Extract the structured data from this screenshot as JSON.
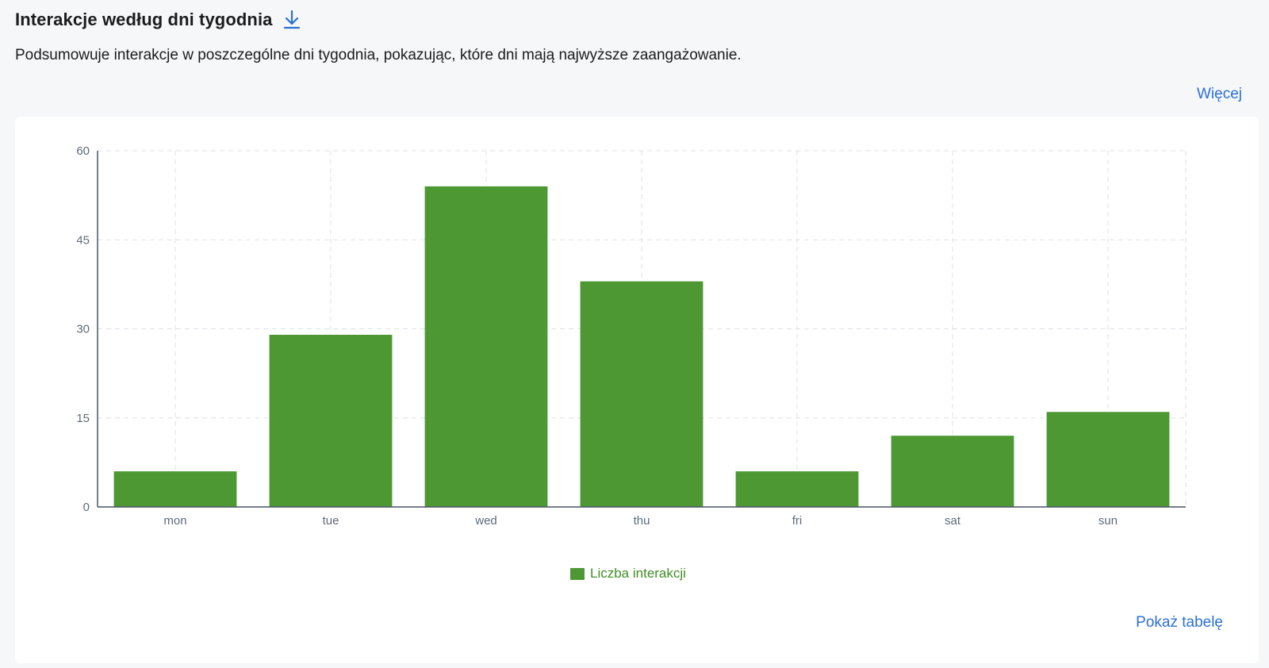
{
  "header": {
    "title": "Interakcje według dni tygodnia",
    "download_icon": "download-icon",
    "description": "Podsumowuje interakcje w poszczególne dni tygodnia, pokazując, które dni mają najwyższe zaangażowanie."
  },
  "links": {
    "more": "Więcej",
    "show_table": "Pokaż tabelę"
  },
  "colors": {
    "bar": "#4e9834",
    "legend_text": "#3f8e24",
    "link": "#2b6fd6",
    "grid": "#dde1e6",
    "axis": "#5f6b7a"
  },
  "chart_data": {
    "type": "bar",
    "categories": [
      "mon",
      "tue",
      "wed",
      "thu",
      "fri",
      "sat",
      "sun"
    ],
    "series": [
      {
        "name": "Liczba interakcji",
        "values": [
          6,
          29,
          54,
          38,
          6,
          12,
          16
        ]
      }
    ],
    "ylim": [
      0,
      60
    ],
    "yticks": [
      0,
      15,
      30,
      45,
      60
    ],
    "title": "",
    "xlabel": "",
    "ylabel": "",
    "grid": true,
    "legend_position": "bottom-center"
  }
}
